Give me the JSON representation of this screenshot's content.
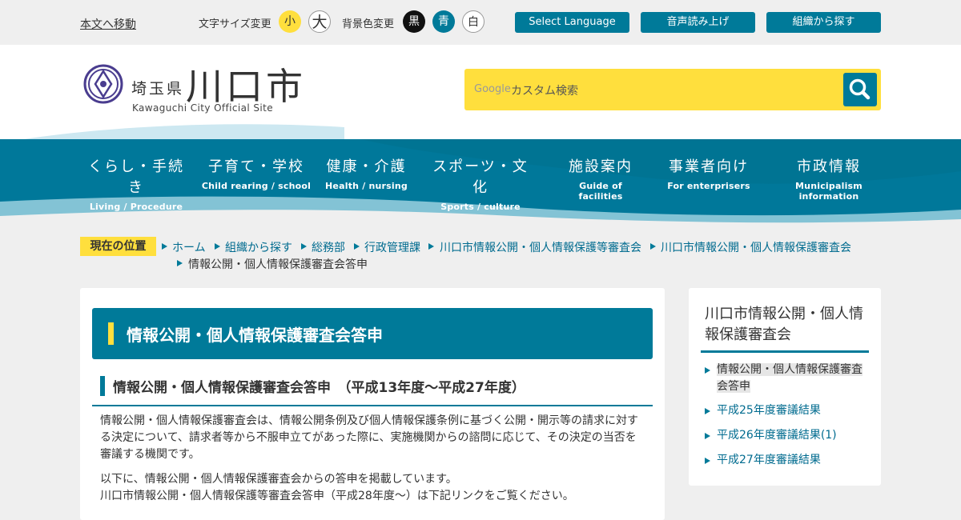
{
  "topbar": {
    "skip_link": "本文へ移動",
    "font_size_label": "文字サイズ変更",
    "font_small": "小",
    "font_large": "大",
    "bg_color_label": "背景色変更",
    "bg_black": "黒",
    "bg_blue": "青",
    "bg_white": "白",
    "select_language": "Select Language",
    "read_aloud": "音声読み上げ",
    "search_by_org": "組織から探す"
  },
  "header": {
    "pref": "埼玉県",
    "city": "川口市",
    "subtitle": "Kawaguchi City Official Site",
    "search_google": "Google",
    "search_placeholder": "カスタム検索"
  },
  "nav": [
    {
      "jp": "くらし・手続き",
      "en": "Living / Procedure"
    },
    {
      "jp": "子育て・学校",
      "en": "Child rearing / school"
    },
    {
      "jp": "健康・介護",
      "en": "Health / nursing"
    },
    {
      "jp": "スポーツ・文化",
      "en": "Sports / culture"
    },
    {
      "jp": "施設案内",
      "en": "Guide of facilities"
    },
    {
      "jp": "事業者向け",
      "en": "For enterprisers"
    },
    {
      "jp": "市政情報",
      "en": "Municipalism  information"
    }
  ],
  "breadcrumb": {
    "label": "現在の位置",
    "items": [
      "ホーム",
      "組織から探す",
      "総務部",
      "行政管理課",
      "川口市情報公開・個人情報保護等審査会",
      "川口市情報公開・個人情報保護審査会",
      "情報公開・個人情報保護審査会答申"
    ]
  },
  "main": {
    "title": "情報公開・個人情報保護審査会答申",
    "subtitle": "情報公開・個人情報保護審査会答申　（平成13年度～平成27年度）",
    "para1": "情報公開・個人情報保護審査会は、情報公開条例及び個人情報保護条例に基づく公開・開示等の請求に対する決定について、請求者等から不服申立てがあった際に、実施機関からの諮問に応じて、その決定の当否を審議する機関です。",
    "para2_line1": "以下に、情報公開・個人情報保護審査会からの答申を掲載しています。",
    "para2_line2": "川口市情報公開・個人情報保護等審査会答申（平成28年度～）は下記リンクをご覧ください。"
  },
  "side": {
    "title": "川口市情報公開・個人情報保護審査会",
    "items": [
      "情報公開・個人情報保護審査会答申",
      "平成25年度審議結果",
      "平成26年度審議結果(1)",
      "平成27年度審議結果"
    ]
  },
  "colors": {
    "accent": "#007a99",
    "highlight": "#ffdf3d",
    "background": "#efefef"
  }
}
